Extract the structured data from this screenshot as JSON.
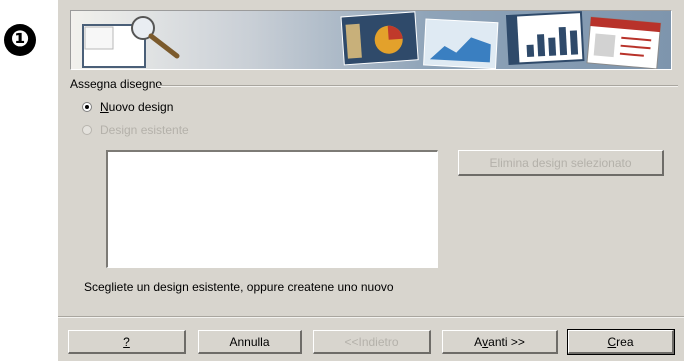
{
  "step_badge": "❶",
  "design_group": {
    "title": "Assegna disegno",
    "options": [
      {
        "label_key": "N",
        "label_rest": "uovo design",
        "selected": true,
        "enabled": true
      },
      {
        "label": "Design esistente",
        "selected": false,
        "enabled": false
      }
    ],
    "delete_button": "Elimina design selezionato"
  },
  "hint_text": "Scegliete un design esistente, oppure createne uno nuovo",
  "footer_buttons": {
    "help": "?",
    "cancel": "Annulla",
    "back": "<<Indietro",
    "next_prefix": "A",
    "next_key": "v",
    "next_suffix": "anti >>",
    "create_key": "C",
    "create_rest": "rea"
  },
  "colors": {
    "dialog_bg": "#d8d5ce",
    "disabled_text": "#b4b1aa",
    "banner_blue": "#7e95ad"
  },
  "icons": {
    "banner_left": "magnifier-over-blank-slide-icon",
    "banner_right": "presentation-thumbnails-icon"
  }
}
